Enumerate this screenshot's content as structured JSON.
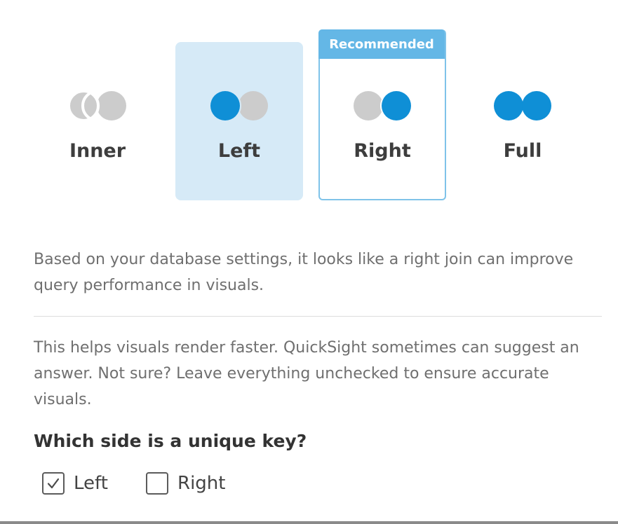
{
  "join_types": {
    "inner": {
      "label": "Inner"
    },
    "left": {
      "label": "Left",
      "selected": true
    },
    "right": {
      "label": "Right",
      "badge": "Recommended"
    },
    "full": {
      "label": "Full"
    }
  },
  "recommendation_text": "Based on your database settings, it looks like a right join can improve query performance in visuals.",
  "help_text": "This helps visuals render faster. QuickSight sometimes can suggest an answer. Not sure? Leave everything unchecked to ensure accurate visuals.",
  "unique_key": {
    "question": "Which side is a unique key?",
    "options": [
      {
        "label": "Left",
        "checked": true
      },
      {
        "label": "Right",
        "checked": false
      }
    ]
  },
  "colors": {
    "accent_blue": "#0f8fd6",
    "inactive_gray": "#cccccc",
    "selected_card_bg": "#d6eaf7",
    "recommended_border": "#7fc3e9",
    "badge_bg": "#64b7e6"
  }
}
